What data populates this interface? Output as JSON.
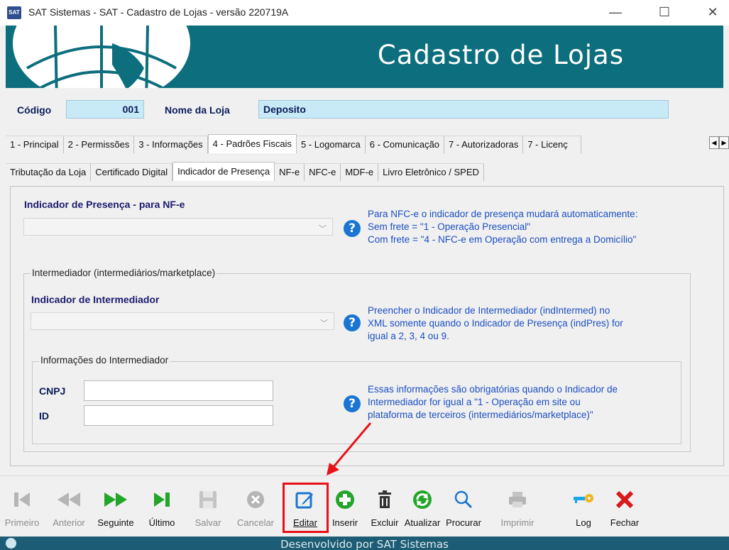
{
  "window": {
    "title": "SAT Sistemas - SAT - Cadastro de Lojas - versão 220719A",
    "icon_text": "SAT",
    "minimize": "—",
    "maximize": "☐",
    "close": "✕"
  },
  "banner": {
    "title": "Cadastro de Lojas"
  },
  "header": {
    "codigo_label": "Código",
    "codigo_value": "001",
    "nome_label": "Nome da Loja",
    "nome_value": "Deposito"
  },
  "tabs": [
    {
      "label": "1 - Principal"
    },
    {
      "label": "2 - Permissões"
    },
    {
      "label": "3 - Informações"
    },
    {
      "label": "4 - Padrões Fiscais",
      "active": true
    },
    {
      "label": "5 - Logomarca"
    },
    {
      "label": "6 - Comunicação"
    },
    {
      "label": "7 - Autorizadoras"
    },
    {
      "label": "7 - Licenç"
    }
  ],
  "subtabs": [
    {
      "label": "Tributação da Loja"
    },
    {
      "label": "Certificado Digital"
    },
    {
      "label": "Indicador de Presença",
      "active": true
    },
    {
      "label": "NF-e"
    },
    {
      "label": "NFC-e"
    },
    {
      "label": "MDF-e"
    },
    {
      "label": "Livro Eletrônico / SPED"
    }
  ],
  "presenca": {
    "title": "Indicador de Presença - para NF-e",
    "combo_value": "",
    "help": [
      "Para NFC-e o indicador de presença mudará automaticamente:",
      "Sem frete = \"1 - Operação Presencial\"",
      "Com frete = \"4 - NFC-e em Operação com entrega a Domicílio\""
    ]
  },
  "intermediador": {
    "group_title": "Intermediador (intermediários/marketplace)",
    "title": "Indicador de Intermediador",
    "combo_value": "",
    "help": [
      "Preencher o Indicador de Intermediador (indIntermed) no",
      "XML somente quando o Indicador de Presença (indPres) for",
      "igual a 2, 3, 4 ou 9."
    ],
    "info_group_title": "Informações do Intermediador",
    "cnpj_label": "CNPJ",
    "cnpj_value": "",
    "id_label": "ID",
    "id_value": "",
    "info_help": [
      "Essas informações são obrigatórias quando o Indicador de",
      "Intermediador for igual a \"1 - Operação em site ou",
      "plataforma de terceiros (intermediários/marketplace)\""
    ]
  },
  "toolbar": [
    {
      "label": "Primeiro",
      "icon": "first-icon",
      "enabled": false
    },
    {
      "label": "Anterior",
      "icon": "previous-icon",
      "enabled": false
    },
    {
      "label": "Seguinte",
      "icon": "next-icon",
      "enabled": true
    },
    {
      "label": "Último",
      "icon": "last-icon",
      "enabled": true
    },
    {
      "label": "Salvar",
      "icon": "save-icon",
      "enabled": false
    },
    {
      "label": "Cancelar",
      "icon": "cancel-icon",
      "enabled": false
    },
    {
      "label": "Editar",
      "icon": "edit-icon",
      "enabled": true,
      "highlighted": true
    },
    {
      "label": "Inserir",
      "icon": "add-icon",
      "enabled": true
    },
    {
      "label": "Excluir",
      "icon": "trash-icon",
      "enabled": true
    },
    {
      "label": "Atualizar",
      "icon": "refresh-icon",
      "enabled": true
    },
    {
      "label": "Procurar",
      "icon": "search-icon",
      "enabled": true
    },
    {
      "label": "Imprimir",
      "icon": "print-icon",
      "enabled": false
    },
    {
      "label": "Log",
      "icon": "key-icon",
      "enabled": true
    },
    {
      "label": "Fechar",
      "icon": "close-icon",
      "enabled": true
    }
  ],
  "status": {
    "text": "Desenvolvido por SAT Sistemas"
  },
  "colors": {
    "banner": "#0d6e7d",
    "field_bg": "#c8eaf7",
    "label": "#0b1c5a",
    "help_text": "#1b4fc2",
    "highlight": "#e8111a",
    "status_bar": "#1c5d75"
  }
}
